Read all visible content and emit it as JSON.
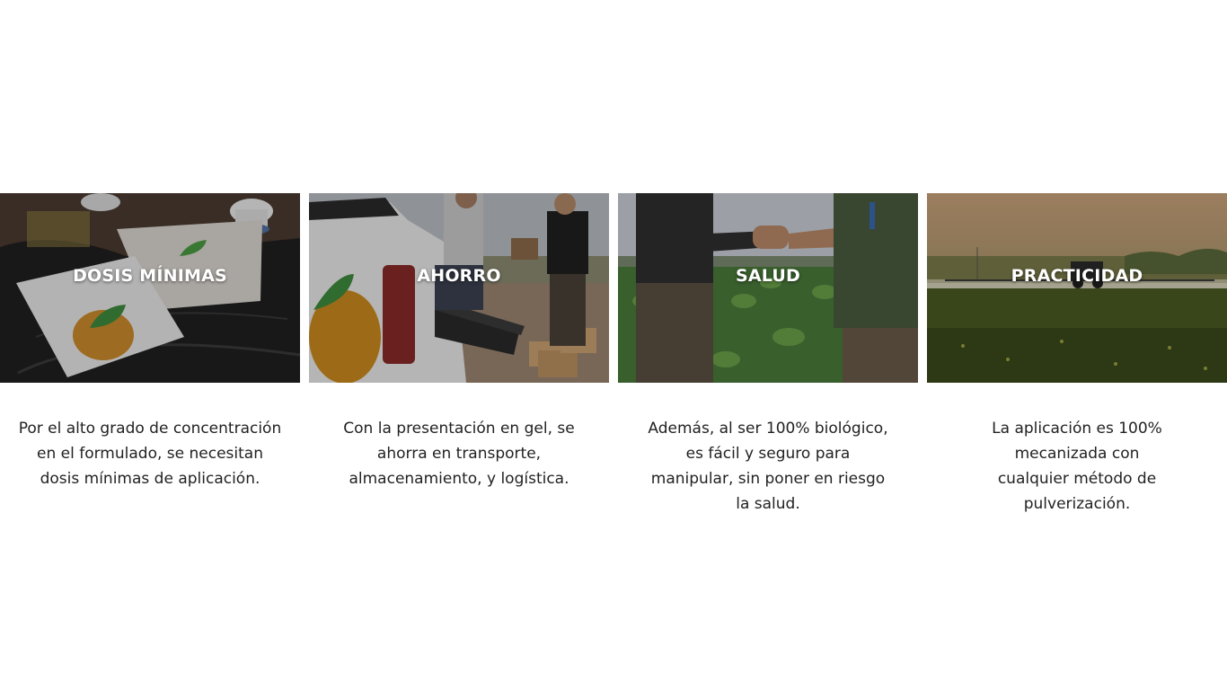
{
  "features": [
    {
      "title": "DOSIS MÍNIMAS",
      "description": "Por el alto grado de concentración en el formulado, se necesitan dosis mínimas de aplicación.",
      "image_icon": "product-packages-image"
    },
    {
      "title": "AHORRO",
      "description": "Con la presentación en gel, se ahorra en transporte, almacenamiento, y logística.",
      "image_icon": "truck-boxes-image"
    },
    {
      "title": "SALUD",
      "description": "Además, al ser 100% biológico, es fácil y seguro para manipular, sin poner en riesgo la salud.",
      "image_icon": "handshake-field-image"
    },
    {
      "title": "PRACTICIDAD",
      "description": "La aplicación es 100% mecanizada con cualquier método de pulverización.",
      "image_icon": "tractor-sprayer-image"
    }
  ],
  "colors": {
    "title_text": "#ffffff",
    "body_text": "#222222",
    "background": "#ffffff"
  }
}
